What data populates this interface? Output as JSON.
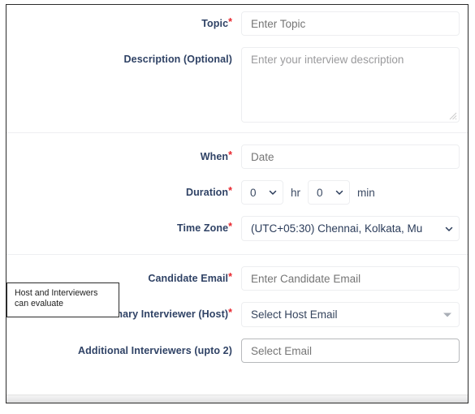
{
  "form": {
    "sections": [
      {
        "name": "details",
        "rows": [
          {
            "key": "topic",
            "label": "Topic",
            "required": true,
            "control": "text",
            "placeholder": "Enter Topic",
            "value": ""
          },
          {
            "key": "description",
            "label": "Description (Optional)",
            "required": false,
            "control": "textarea",
            "placeholder": "Enter your interview description",
            "value": ""
          }
        ]
      },
      {
        "name": "schedule",
        "rows": [
          {
            "key": "when",
            "label": "When",
            "required": true,
            "control": "text",
            "placeholder": "Date",
            "value": ""
          },
          {
            "key": "duration",
            "label": "Duration",
            "required": true,
            "control": "duration",
            "hours_value": "0",
            "hours_unit": "hr",
            "minutes_value": "0",
            "minutes_unit": "min"
          },
          {
            "key": "timezone",
            "label": "Time Zone",
            "required": true,
            "control": "select",
            "value": "(UTC+05:30) Chennai, Kolkata, Mu"
          }
        ]
      },
      {
        "name": "participants",
        "rows": [
          {
            "key": "candidate_email",
            "label": "Candidate Email",
            "required": true,
            "control": "text",
            "placeholder": "Enter Candidate Email",
            "value": ""
          },
          {
            "key": "primary_interviewer",
            "label": "Primary Interviewer (Host)",
            "required": true,
            "control": "combo",
            "value": "Select Host Email"
          },
          {
            "key": "additional_interviewers",
            "label": "Additional Interviewers (upto 2)",
            "required": false,
            "control": "text-strong",
            "placeholder": "Select Email",
            "value": ""
          }
        ]
      }
    ],
    "required_marker": "*"
  },
  "annotation": {
    "text": "Host and Interviewers\ncan evaluate"
  },
  "colors": {
    "label": "#2f4265",
    "required": "#e8262d",
    "placeholder": "#9a9a9c",
    "border": "#edeef0",
    "frame": "#2b2b2b"
  },
  "icons": {
    "chevron_down": "chevron-down-icon",
    "caret_down": "caret-down-icon",
    "resize_grip": "resize-grip-icon"
  }
}
